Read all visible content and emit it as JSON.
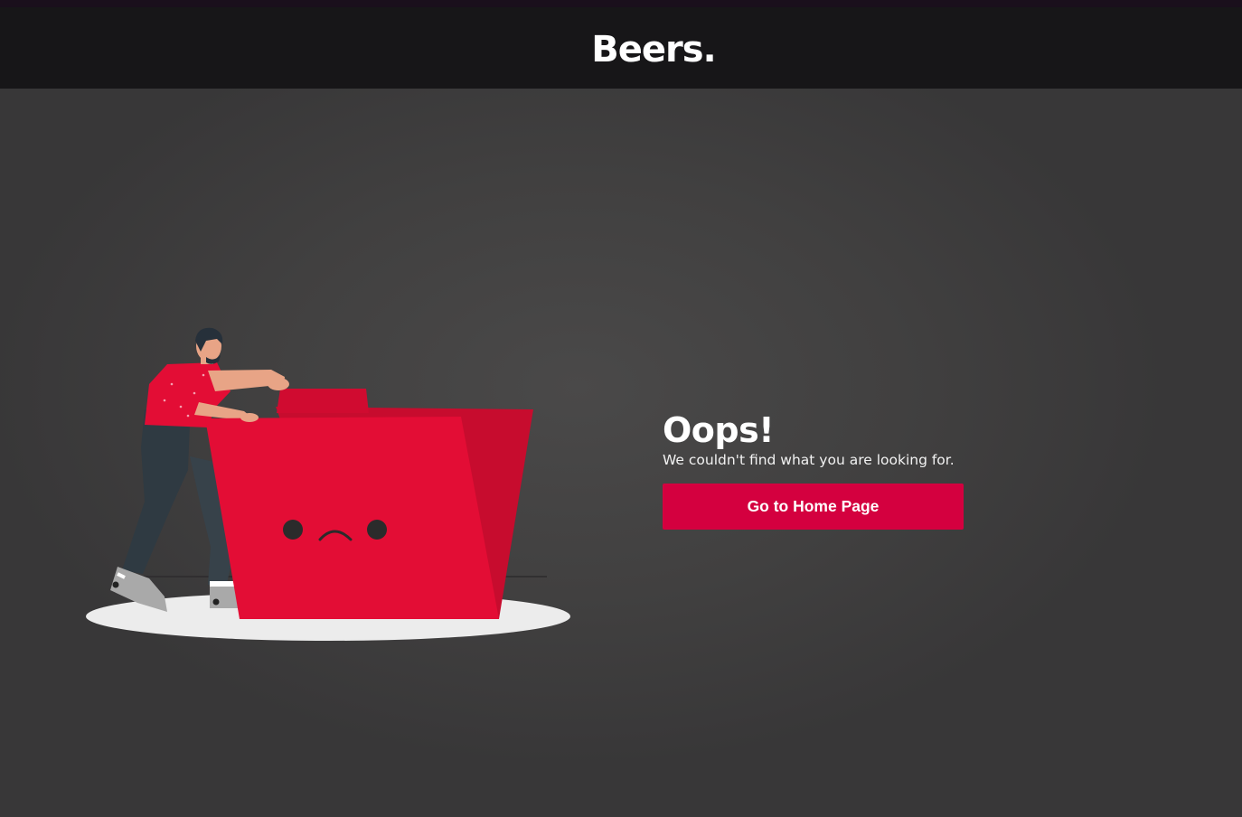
{
  "header": {
    "logo_text": "Beers."
  },
  "error": {
    "title": "Oops!",
    "message": "We couldn't find what you are looking for.",
    "home_button_label": "Go to Home Page"
  },
  "colors": {
    "header_bg": "#171618",
    "page_bg": "#414040",
    "accent": "#d4003f",
    "folder_red": "#e30d35",
    "text": "#ffffff"
  },
  "illustration": {
    "icon": "sad-folder-illustration"
  }
}
